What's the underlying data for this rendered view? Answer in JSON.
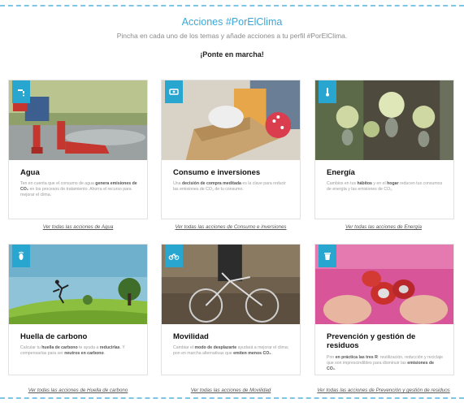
{
  "header": {
    "title": "Acciones #PorElClima",
    "subtitle": "Pincha en cada uno de los temas y añade acciones a tu perfil #PorElClima.",
    "cta": "¡Ponte en marcha!"
  },
  "colors": {
    "accent": "#28a6cf",
    "title": "#3aa8d8",
    "dash": "#7fc6e6"
  },
  "cards": [
    {
      "icon": "water-tap-icon",
      "title": "Agua",
      "desc_parts": [
        "Ten en cuenta que el consumo de agua ",
        "genera emisiones de CO₂",
        " en los procesos de tratamiento. Ahorra el recurso para mejorar el clima."
      ],
      "link": "Ver todas las acciones de Agua"
    },
    {
      "icon": "cash-icon",
      "title": "Consumo e inversiones",
      "desc_parts": [
        "Una ",
        "decisión de compra meditada",
        " es la clave para reducir las emisiones de CO₂ de tu consumo."
      ],
      "link": "Ver todas las acciones de Consumo e inversiones"
    },
    {
      "icon": "thermometer-icon",
      "title": "Energía",
      "desc_parts": [
        "Cambios en tus ",
        "hábitos",
        " y en el ",
        "hogar",
        " reducen tus consumos de energía y las emisiones de CO₂."
      ],
      "link": "Ver todas las acciones de Energía"
    },
    {
      "icon": "footprint-icon",
      "title": "Huella de carbono",
      "desc_parts": [
        "Calcular tu ",
        "huella de carbono",
        " te ayuda a ",
        "reducirlas",
        ". Y compensarlas para ser ",
        "neutros en carbono",
        "."
      ],
      "link": "Ver todas las acciones de Huella de carbono"
    },
    {
      "icon": "bicycle-icon",
      "title": "Movilidad",
      "desc_parts": [
        "Cambiar el ",
        "modo de desplazarte",
        " ayudará a mejorar el clima; pon en marcha alternativas que ",
        "emiten menos CO₂",
        "."
      ],
      "link": "Ver todas las acciones de Movilidad"
    },
    {
      "icon": "recycle-bin-icon",
      "title": "Prevención y gestión de residuos",
      "desc_parts": [
        "Pon ",
        "en práctica las tres R",
        ": reutilización, reducción y reciclaje que son imprescindibles para disminuir las ",
        "emisiones de CO₂",
        "."
      ],
      "link": "Ver todas las acciones de Prevención y gestión de residuos"
    }
  ]
}
